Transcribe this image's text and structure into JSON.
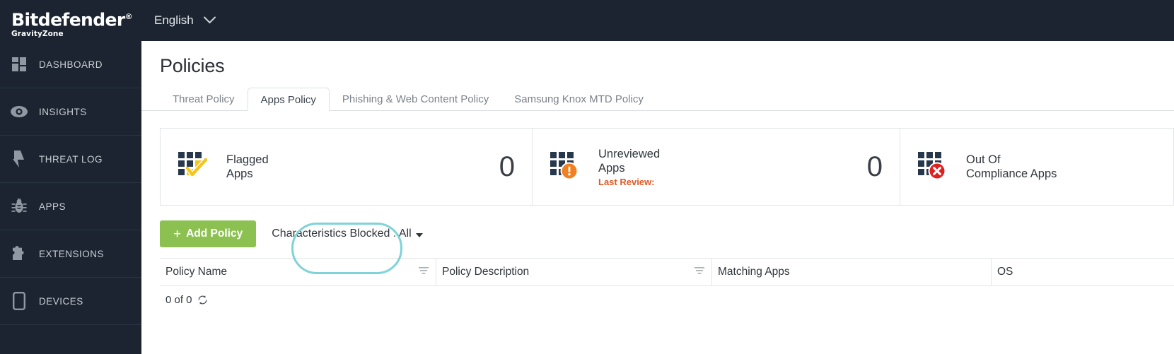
{
  "brand": {
    "name": "Bitdefender",
    "registered": "®",
    "sub": "GravityZone"
  },
  "topbar": {
    "language": "English",
    "chevron_icon": "chevron-down-icon"
  },
  "sidebar": {
    "items": [
      {
        "label": "DASHBOARD",
        "icon": "dashboard-grid-icon"
      },
      {
        "label": "INSIGHTS",
        "icon": "eye-icon"
      },
      {
        "label": "THREAT LOG",
        "icon": "lightning-bolt-icon"
      },
      {
        "label": "APPS",
        "icon": "bug-icon"
      },
      {
        "label": "EXTENSIONS",
        "icon": "puzzle-piece-icon"
      },
      {
        "label": "DEVICES",
        "icon": "mobile-phone-icon"
      }
    ]
  },
  "page": {
    "title": "Policies"
  },
  "tabs": [
    {
      "label": "Threat Policy",
      "active": false
    },
    {
      "label": "Apps Policy",
      "active": true
    },
    {
      "label": "Phishing & Web Content Policy",
      "active": false
    },
    {
      "label": "Samsung Knox MTD Policy",
      "active": false
    }
  ],
  "cards": [
    {
      "label_line1": "Flagged",
      "label_line2": "Apps",
      "value": "0",
      "icon": "grid-check-icon",
      "accent": "#f5c518",
      "sub": ""
    },
    {
      "label_line1": "Unreviewed",
      "label_line2": "Apps",
      "value": "0",
      "icon": "grid-warning-icon",
      "accent": "#f08021",
      "sub": "Last Review:"
    },
    {
      "label_line1": "Out Of",
      "label_line2": "Compliance Apps",
      "value": "",
      "icon": "grid-error-icon",
      "accent": "#e02020",
      "sub": ""
    }
  ],
  "toolbar": {
    "add_label": "Add Policy",
    "add_plus": "+",
    "add_color": "#8cc152",
    "highlight_color": "#7fd3d8",
    "filter_label": "Characteristics Blocked : All"
  },
  "table": {
    "columns": [
      {
        "label": "Policy Name",
        "filter_icon": "funnel-filter-icon",
        "has_filter": true
      },
      {
        "label": "Policy Description",
        "filter_icon": "funnel-filter-icon",
        "has_filter": true
      },
      {
        "label": "Matching Apps",
        "filter_icon": "",
        "has_filter": false
      },
      {
        "label": "OS",
        "filter_icon": "",
        "has_filter": false
      }
    ],
    "rows": [],
    "footer_count": "0 of 0",
    "refresh_icon": "refresh-icon"
  }
}
